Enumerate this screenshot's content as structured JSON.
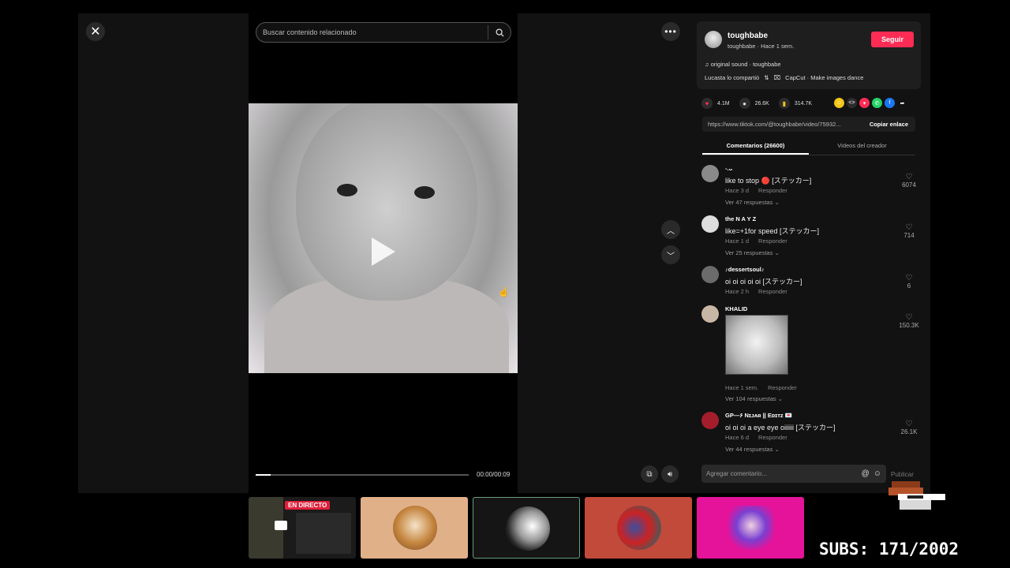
{
  "search": {
    "placeholder": "Buscar contenido relacionado"
  },
  "video": {
    "time": "00:00/00:09",
    "progress": 0.07
  },
  "creator": {
    "name": "toughbabe",
    "subtitle": "toughbabe · Hace 1 sem.",
    "follow_label": "Seguir",
    "sound": "original sound · toughbabe",
    "shared_by": "Lucasta lo compartió",
    "effect": "CapCut · Make images dance"
  },
  "stats": {
    "likes": "4.1M",
    "comments": "26.6K",
    "saves": "314.7K"
  },
  "link": {
    "url": "https://www.tiktok.com/@toughbabe/video/75932...",
    "copy_label": "Copiar enlace"
  },
  "tabs": {
    "comments": "Comentarios (26600)",
    "creator_videos": "Videos del creador"
  },
  "comments": [
    {
      "name": "-.ᴗ",
      "text": "like to stop 🔴 [ステッカー]",
      "time": "Hace 3 d",
      "reply": "Responder",
      "replies": "Ver 47 respuestas ⌄",
      "likes": "6074"
    },
    {
      "name": "the N A Y Z",
      "text": "like=+1for speed [ステッカー]",
      "time": "Hace 1 d",
      "reply": "Responder",
      "replies": "Ver 25 respuestas ⌄",
      "likes": "714"
    },
    {
      "name": "♪dessertsoul♪",
      "text": "oi oi oi oi oi [ステッカー]",
      "time": "Hace 2 h",
      "reply": "Responder",
      "replies": "",
      "likes": "6"
    },
    {
      "name": "KHALID",
      "text": "",
      "time": "Hace 1 sem.",
      "reply": "Responder",
      "replies": "Ver 104 respuestas ⌄",
      "likes": "150.3K"
    },
    {
      "name": "GP—۶ Nɪᴊᴀʀ || Eᴅɪᴛᴢ 💌",
      "text": "oi oi oi a eye eye oiiiiii [ステッカー]",
      "time": "Hace 6 d",
      "reply": "Responder",
      "replies": "Ver 44 respuestas ⌄",
      "likes": "26.1K"
    }
  ],
  "comment_input": {
    "placeholder": "Agregar comentario...",
    "publish": "Publicar"
  },
  "stream": {
    "live_badge": "EN DIRECTO",
    "subs": "SUBS: 171/2002"
  },
  "colors": {
    "accent": "#fe2c55",
    "panel": "#121212",
    "live": "#e0203a"
  }
}
